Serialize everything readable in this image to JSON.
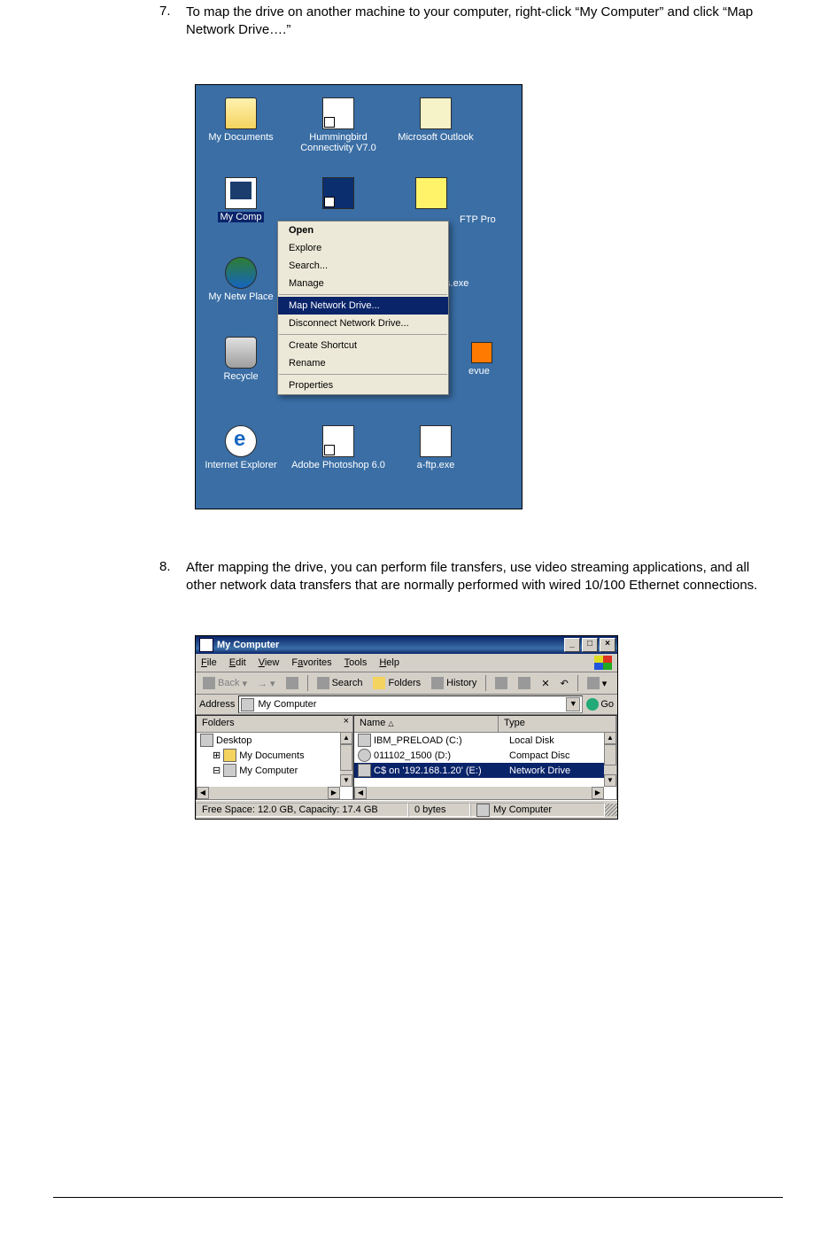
{
  "doc": {
    "step7_num": "7.",
    "step7_text": "To map the drive on another machine to your computer, right-click “My Computer” and click “Map Network Drive….”",
    "step8_num": "8.",
    "step8_text": "After mapping the drive, you can perform file transfers, use video streaming applications, and all other network data transfers that are normally performed with wired 10/100 Ethernet connections."
  },
  "desktop": {
    "icons": {
      "my_documents": "My Documents",
      "hummingbird": "Hummingbird Connectivity V7.0",
      "outlook": "Microsoft Outlook",
      "my_computer": "My Comp",
      "ftp_pro_vis": " FTP Pro",
      "my_network_places": "My Netw Place",
      "ons_exe_vis": "ns.exe",
      "recycle_bin": "Recycle",
      "evue_vis": "evue",
      "ie": "Internet Explorer",
      "photoshop": "Adobe Photoshop 6.0",
      "a_ftp": "a-ftp.exe"
    },
    "ctx": {
      "open": "Open",
      "explore": "Explore",
      "search": "Search...",
      "manage": "Manage",
      "map": "Map Network Drive...",
      "disconnect": "Disconnect Network Drive...",
      "shortcut": "Create Shortcut",
      "rename": "Rename",
      "properties": "Properties"
    }
  },
  "explorer": {
    "title": "My Computer",
    "menu": {
      "file": "File",
      "edit": "Edit",
      "view": "View",
      "fav": "Favorites",
      "tools": "Tools",
      "help": "Help"
    },
    "toolbar": {
      "back": "Back",
      "search": "Search",
      "folders": "Folders",
      "history": "History"
    },
    "address_label": "Address",
    "address_value": "My Computer",
    "go": "Go",
    "folders_pane_title": "Folders",
    "tree": {
      "desktop": "Desktop",
      "mydocs": "My Documents",
      "mycomp": "My Computer"
    },
    "cols": {
      "name": "Name",
      "type": "Type"
    },
    "rows": [
      {
        "name": "IBM_PRELOAD (C:)",
        "type": "Local Disk"
      },
      {
        "name": "011102_1500 (D:)",
        "type": "Compact Disc"
      },
      {
        "name": "C$ on '192.168.1.20' (E:)",
        "type": "Network Drive"
      }
    ],
    "status": {
      "left": "Free Space: 12.0 GB, Capacity: 17.4 GB",
      "mid": "0 bytes",
      "right": "My Computer"
    }
  }
}
